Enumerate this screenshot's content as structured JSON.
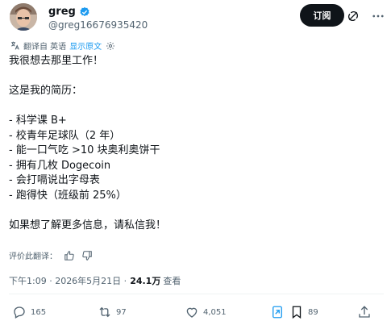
{
  "header": {
    "name": "greg",
    "handle": "@greg16676935420",
    "subscribe_label": "订阅"
  },
  "translation": {
    "label": "翻译自 英语",
    "show_original": "显示原文"
  },
  "post": {
    "text": "我很想去那里工作！\n\n这是我的简历：\n\n- 科学课 B+\n- 校青年足球队（2 年）\n- 能一口气吃 >10 块奥利奥饼干\n- 拥有几枚 Dogecoin\n- 会打嗝说出字母表\n- 跑得快（班级前 25%）\n\n如果想了解更多信息，请私信我！"
  },
  "rating": {
    "label": "评价此翻译："
  },
  "meta": {
    "time_date": "下午1:09 · 2026年5月21日 ·",
    "views": "24.1万",
    "views_label": "查看"
  },
  "actions": {
    "replies": "165",
    "reposts": "97",
    "likes": "4,051",
    "bookmarks": "89"
  },
  "colors": {
    "accent": "#1d9bf0",
    "text": "#0f1419",
    "muted": "#536471",
    "button": "#0f1419",
    "bookmark": "#1d9bf0"
  }
}
